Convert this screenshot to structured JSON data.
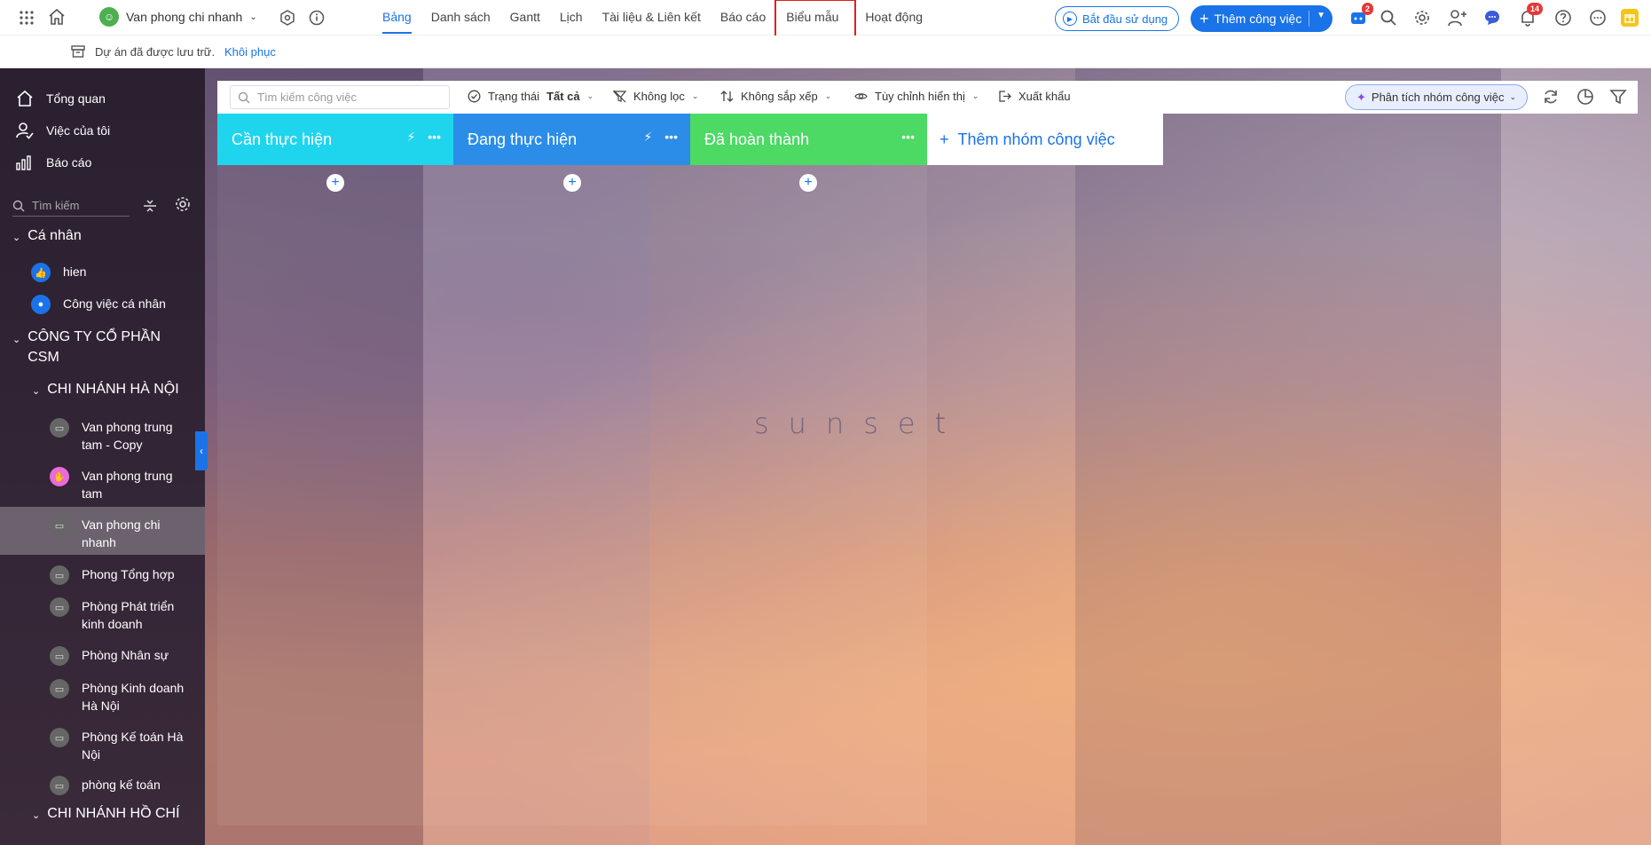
{
  "topbar": {
    "project_name": "Van phong chi nhanh",
    "tabs": [
      {
        "label": "Bảng",
        "active": true
      },
      {
        "label": "Danh sách"
      },
      {
        "label": "Gantt"
      },
      {
        "label": "Lịch"
      },
      {
        "label": "Tài liệu & Liên kết"
      },
      {
        "label": "Báo cáo"
      },
      {
        "label": "Biểu mẫu",
        "highlighted": true
      },
      {
        "label": "Hoạt động"
      }
    ],
    "start_button": "Bắt đầu sử dụng",
    "add_task_button": "Thêm công việc",
    "cart_badge": "2",
    "notif_badge": "14"
  },
  "archived": {
    "text": "Dự án đã được lưu trữ.",
    "restore": "Khôi phục"
  },
  "sidebar": {
    "nav": [
      "Tổng quan",
      "Việc của tôi",
      "Báo cáo"
    ],
    "search_placeholder": "Tìm kiếm",
    "personal": "Cá nhân",
    "personal_items": [
      "hien",
      "Công việc cá nhân"
    ],
    "company": "CÔNG TY CỔ PHẦN CSM",
    "branch_hn": "CHI NHÁNH HÀ NỘI",
    "branch_items": [
      "Van phong trung tam - Copy",
      "Van phong trung tam",
      "Van phong chi nhanh",
      "Phong Tổng hợp",
      "Phòng Phát triển kinh doanh",
      "Phòng Nhân sự",
      "Phòng Kinh doanh Hà Nội",
      "Phòng Kế toán Hà Nội",
      "phòng kế toán"
    ],
    "branch_hcm": "CHI NHÁNH HỒ CHÍ"
  },
  "board": {
    "search_placeholder": "Tìm kiếm công việc",
    "status_label": "Trạng thái",
    "status_value": "Tất cả",
    "filter_label": "Không lọc",
    "sort_label": "Không sắp xếp",
    "display_label": "Tùy chỉnh hiển thị",
    "export_label": "Xuất khẩu",
    "analysis_button": "Phân tích nhóm công việc",
    "columns": [
      {
        "title": "Cần thực hiện",
        "color": "#1fd5ee"
      },
      {
        "title": "Đang thực hiện",
        "color": "#2b8de8"
      },
      {
        "title": "Đã hoàn thành",
        "color": "#4cd964"
      }
    ],
    "add_group": "Thêm nhóm công việc",
    "background_text": "sunset"
  }
}
